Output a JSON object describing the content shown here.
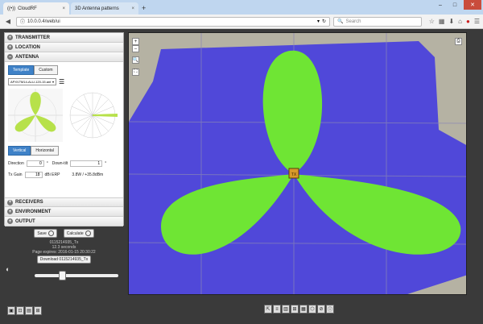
{
  "browser": {
    "tabs": [
      {
        "label": "CloudRF",
        "close": "×"
      },
      {
        "label": "3D Antenna patterns",
        "close": "×"
      }
    ],
    "newtab": "+",
    "window_controls": {
      "minimize": "–",
      "maximize": "□",
      "close": "✕"
    },
    "url": "10.0.0.4/web/ui",
    "search_placeholder": "Search",
    "back": "◀",
    "info": "ⓘ",
    "dropdown": "▾",
    "reload": "↻",
    "search_icon": "🔍",
    "toolbar_icons": [
      "☆",
      "▦",
      "⬇",
      "⌂",
      "●",
      "☰"
    ]
  },
  "panel": {
    "sections": {
      "transmitter": "TRANSMITTER",
      "location": "LOCATION",
      "antenna": "ANTENNA",
      "receivers": "RECEIVERS",
      "environment": "ENVIRONMENT",
      "output": "OUTPUT"
    },
    "expand": "+",
    "collapse": "–",
    "antenna": {
      "tab_template": "Template",
      "tab_custom": "Custom",
      "template_value": "APXV7M14-ALU-120-15.ant",
      "list_icon": "☰",
      "select_arrow": "▾",
      "view_vertical": "Vertical",
      "view_horizontal": "Horizontal",
      "direction_label": "Direction",
      "direction_value": "0",
      "deg": "°",
      "downtilt_label": "Down-tilt",
      "downtilt_value": "1",
      "txgain_label": "Tx Gain",
      "txgain_value": "18",
      "txgain_unit": "dBi ERP",
      "erp_value": "3.8W / +35.8dBm"
    }
  },
  "controls": {
    "save": "Save",
    "calculate": "Calculate",
    "info_lines": [
      "0115214935_Tx",
      "12.3 seconds",
      "Page expires: 2016-01-15 20:30:22"
    ],
    "download": "Download 0115214935_Tx"
  },
  "map": {
    "zoom_in": "+",
    "zoom_out": "–",
    "search": "🔍",
    "fullscreen": "⛶",
    "print": "⎙",
    "tx_marker": "TX",
    "colors": {
      "coverage": "#6fe534",
      "weak": "#5048d9",
      "terrain": "#b5b2a3"
    }
  },
  "bottom_tools": [
    "⇱",
    "≡",
    "▥",
    "⊞",
    "▦",
    "⬡",
    "⊘",
    "ⓘ"
  ],
  "left_tools": [
    "▣",
    "⊡",
    "▤",
    "⊞"
  ],
  "contrast_icon": "◐"
}
